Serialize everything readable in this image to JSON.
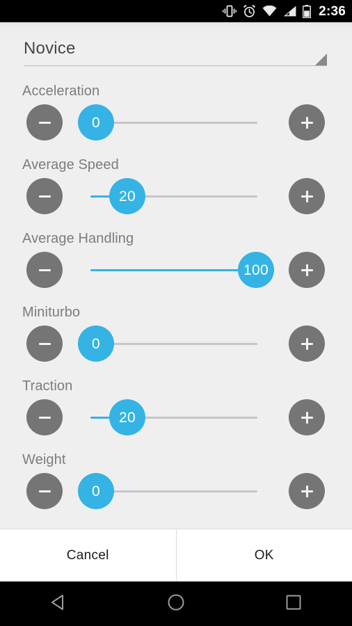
{
  "statusbar": {
    "time": "2:36",
    "icons": [
      "vibrate-icon",
      "alarm-icon",
      "wifi-icon",
      "cellular-signal-icon",
      "battery-icon"
    ]
  },
  "spinner": {
    "selected": "Novice",
    "arrow": "dropdown-arrow-icon"
  },
  "colors": {
    "accent": "#34b3e4",
    "button_gray": "#757575",
    "track": "#c6c6c6",
    "label": "#7c7c7c",
    "background": "#efefef"
  },
  "slider_min": 0,
  "slider_max": 100,
  "decrement_label": "-",
  "increment_label": "+",
  "rows": [
    {
      "label": "Acceleration",
      "value": "0",
      "percent": 0
    },
    {
      "label": "Average Speed",
      "value": "20",
      "percent": 20
    },
    {
      "label": "Average Handling",
      "value": "100",
      "percent": 100
    },
    {
      "label": "Miniturbo",
      "value": "0",
      "percent": 0
    },
    {
      "label": "Traction",
      "value": "20",
      "percent": 20
    },
    {
      "label": "Weight",
      "value": "0",
      "percent": 0
    }
  ],
  "buttons": {
    "cancel": "Cancel",
    "ok": "OK"
  },
  "navbar": {
    "back": "back-triangle-icon",
    "home": "home-circle-icon",
    "recents": "recents-square-icon"
  }
}
